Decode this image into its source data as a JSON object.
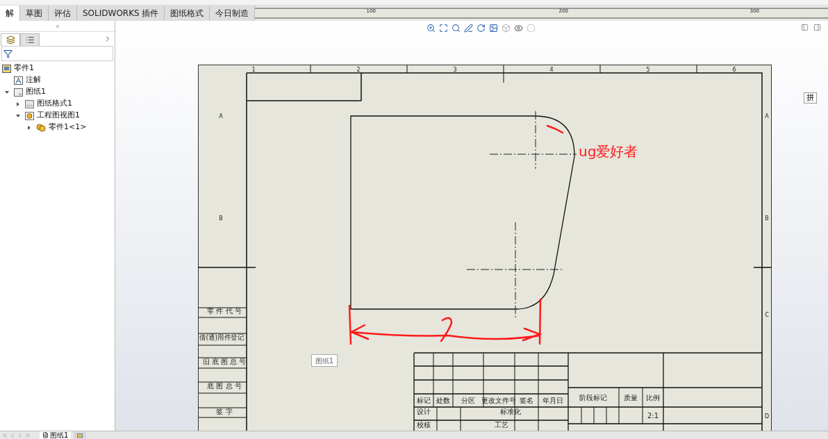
{
  "ribbon_tabs": [
    {
      "label": "解",
      "selected": true
    },
    {
      "label": "草图",
      "selected": false
    },
    {
      "label": "评估",
      "selected": false
    },
    {
      "label": "SOLIDWORKS 插件",
      "selected": false
    },
    {
      "label": "图纸格式",
      "selected": false
    },
    {
      "label": "今日制造",
      "selected": false
    }
  ],
  "ruler": {
    "labels": [
      "100",
      "200",
      "300"
    ]
  },
  "panel_tabs": [
    {
      "kind": "tree",
      "selected": true
    },
    {
      "kind": "properties",
      "selected": false
    }
  ],
  "tree": [
    {
      "label": "零件1",
      "kind": "part-document",
      "children": [
        {
          "label": "注解",
          "kind": "annotation"
        },
        {
          "label": "图纸1",
          "kind": "sheet",
          "expanded": true,
          "children": [
            {
              "label": "图纸格式1",
              "kind": "sheet-format",
              "expanded": false
            },
            {
              "label": "工程图视图1",
              "kind": "view",
              "expanded": true,
              "children": [
                {
                  "label": "零件1<1>",
                  "kind": "component",
                  "expanded": false
                }
              ]
            }
          ]
        }
      ]
    }
  ],
  "sheet": {
    "column_labels": [
      "1",
      "2",
      "3",
      "4",
      "5",
      "6"
    ],
    "row_labels_left": [
      "A",
      "B"
    ],
    "row_labels_right": [
      "A",
      "B",
      "C",
      "D"
    ],
    "side_table": [
      "零 件 代 号",
      "借(通)用件登记",
      "旧 底 图 总 号",
      "底 图 总 号",
      "签 字"
    ],
    "sheet_label": "图纸1",
    "title_block": {
      "header": [
        "标记",
        "处数",
        "分区",
        "更改文件号",
        "签名",
        "年月日"
      ],
      "stage_header": [
        "阶段标记",
        "质量",
        "比例"
      ],
      "scale": "2:1",
      "rows": [
        [
          "设计",
          "标准化"
        ],
        [
          "校核",
          "工艺"
        ]
      ]
    },
    "markup_text": "ug爱好者"
  },
  "side_badge": "拼",
  "sheet_tabs": [
    {
      "label": "图纸1",
      "selected": true
    }
  ]
}
